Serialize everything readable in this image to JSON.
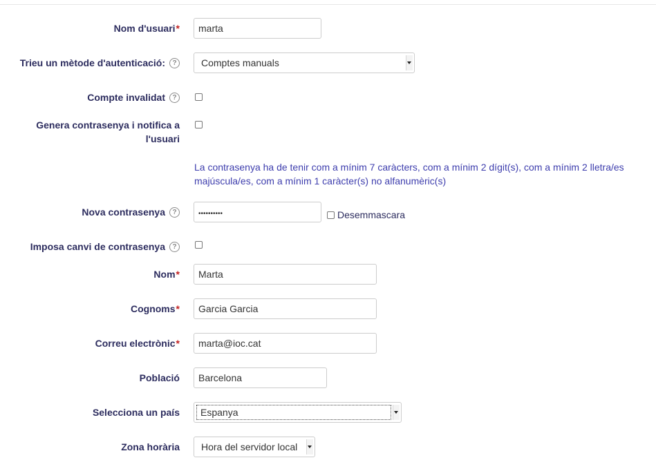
{
  "form": {
    "username": {
      "label": "Nom d'usuari",
      "required_mark": "*",
      "value": "marta"
    },
    "auth": {
      "label": "Trieu un mètode d'autenticació:",
      "value": "Comptes manuals"
    },
    "suspended": {
      "label": "Compte invalidat",
      "checked": false
    },
    "generate_password": {
      "label_line1": "Genera contrasenya i notifica a",
      "label_line2": "l'usuari",
      "checked": false
    },
    "password_rule": "La contrasenya ha de tenir com a mínim 7 caràcters, com a mínim 2 dígit(s), com a mínim 2 lletra/es majúscula/es, com a mínim 1 caràcter(s) no alfanumèric(s)",
    "new_password": {
      "label": "Nova contrasenya",
      "masked_value": "••••••••••",
      "unmask_label": "Desemmascara"
    },
    "force_change": {
      "label": "Imposa canvi de contrasenya",
      "checked": false
    },
    "firstname": {
      "label": "Nom",
      "required_mark": "*",
      "value": "Marta"
    },
    "lastname": {
      "label": "Cognoms",
      "required_mark": "*",
      "value": "Garcia Garcia"
    },
    "email": {
      "label": "Correu electrònic",
      "required_mark": "*",
      "value": "marta@ioc.cat"
    },
    "city": {
      "label": "Població",
      "value": "Barcelona"
    },
    "country": {
      "label": "Selecciona un país",
      "value": "Espanya"
    },
    "timezone": {
      "label": "Zona horària",
      "value": "Hora del servidor local"
    }
  },
  "icons": {
    "help": "help-question-icon",
    "select": "chevron-down-icon"
  },
  "colors": {
    "label": "#2c2c5e",
    "required": "#c22020",
    "note": "#3d3dad",
    "border": "#cccccc"
  }
}
